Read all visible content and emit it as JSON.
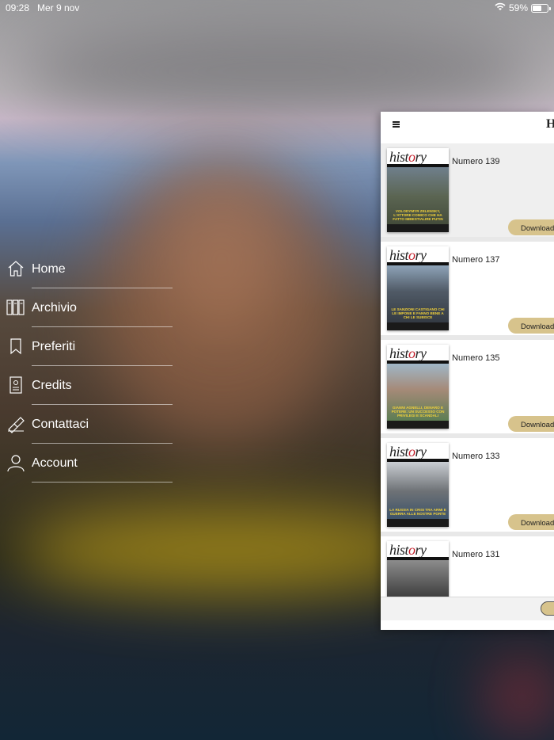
{
  "status_bar": {
    "time": "09:28",
    "date": "Mer 9 nov",
    "battery": "59%",
    "battery_level": 0.59
  },
  "menu": {
    "items": [
      {
        "label": "Home",
        "icon": "home-icon"
      },
      {
        "label": "Archivio",
        "icon": "archive-icon"
      },
      {
        "label": "Preferiti",
        "icon": "bookmark-icon"
      },
      {
        "label": "Credits",
        "icon": "credits-icon"
      },
      {
        "label": "Contattaci",
        "icon": "pen-icon"
      },
      {
        "label": "Account",
        "icon": "user-icon"
      }
    ]
  },
  "panel": {
    "logo_mark": "H",
    "issues": [
      {
        "title": "Numero 139",
        "button": "Download",
        "cover_caption": "VOLODYMYR ZELENSKY, L'ATTORE COMICO CHE HA FATTO IMBESTIALIRE PUTIN"
      },
      {
        "title": "Numero 137",
        "button": "Download",
        "cover_caption": "LE SANZIONI CASTIGANO CHI LE IMPONE E FANNO BENE A CHI LE SUBISCE"
      },
      {
        "title": "Numero 135",
        "button": "Download",
        "cover_caption": "GIANNI AGNELLI, DENARO E POTERE: UN SUCCESSO CON PRIVILEGI E SCANDALI"
      },
      {
        "title": "Numero 133",
        "button": "Download",
        "cover_caption": "LA RUSSIA IN CRISI TRA ARMI E GUERRA ALLE NOSTRE PORTE"
      },
      {
        "title": "Numero 131",
        "button": "",
        "cover_caption": ""
      }
    ],
    "cover_masthead": "history"
  },
  "colors": {
    "accent_gold": "#d7c38c",
    "panel_bg": "#ffffff"
  }
}
